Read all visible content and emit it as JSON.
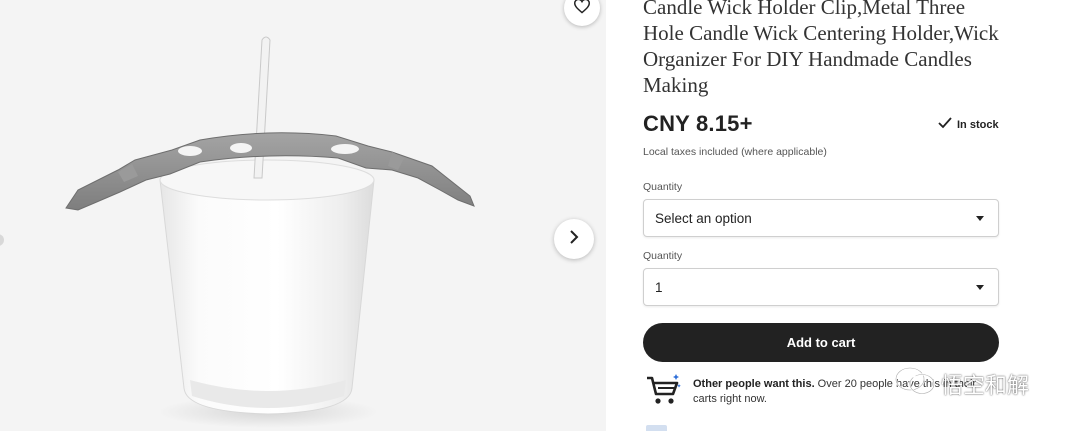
{
  "product": {
    "title": "Candle Wick Holder Clip,Metal Three Hole Candle Wick Centering Holder,Wick Organizer For DIY Handmade Candles Making",
    "price": "CNY 8.15+",
    "stock_status": "In stock",
    "taxes_note": "Local taxes included (where applicable)"
  },
  "options": {
    "first": {
      "label": "Quantity",
      "value": "Select an option"
    },
    "second": {
      "label": "Quantity",
      "value": "1"
    }
  },
  "cart": {
    "button_label": "Add to cart"
  },
  "demand": {
    "bold": "Other people want this.",
    "rest": " Over 20 people have this in their carts right now."
  },
  "media": {
    "favorite_icon": "heart-icon",
    "next_icon": "chevron-right-icon"
  },
  "watermark": {
    "text": "悟空和解"
  },
  "colors": {
    "button_bg": "#222222",
    "text": "#222222",
    "image_bg": "#f4f4f4"
  }
}
